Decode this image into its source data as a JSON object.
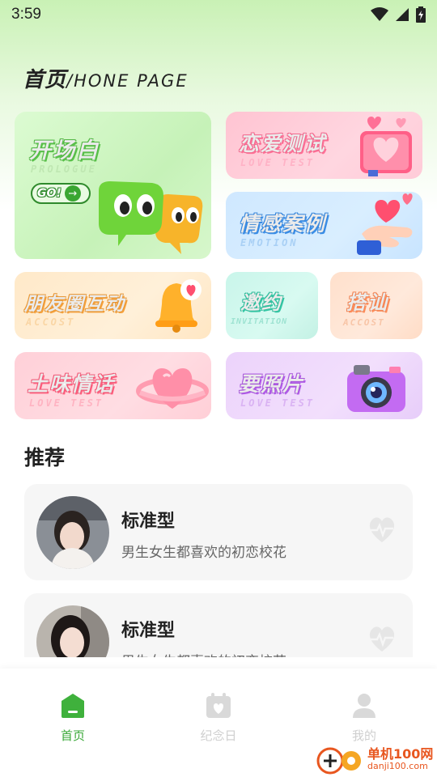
{
  "status_bar": {
    "time": "3:59"
  },
  "header": {
    "title": "首页",
    "subtitle": "/HONE PAGE"
  },
  "cards": {
    "prologue": {
      "title": "开场白",
      "subtitle": "PROLOGUE",
      "button": "GO!"
    },
    "love_test": {
      "title": "恋爱测试",
      "subtitle": "LOVE TEST"
    },
    "emotion": {
      "title": "情感案例",
      "subtitle": "EMOTION"
    },
    "moments": {
      "title": "朋友圈互动",
      "subtitle": "ACCOST"
    },
    "invitation": {
      "title": "邀约",
      "subtitle": "INVITATION"
    },
    "accost": {
      "title": "搭讪",
      "subtitle": "ACCOST"
    },
    "cheesy": {
      "title": "土味情话",
      "subtitle": "LOVE TEST"
    },
    "photo": {
      "title": "要照片",
      "subtitle": "LOVE TEST"
    }
  },
  "recommend": {
    "title": "推荐",
    "items": [
      {
        "name": "标准型",
        "desc": "男生女生都喜欢的初恋校花"
      },
      {
        "name": "标准型",
        "desc": "男生女生都喜欢的初恋校花"
      }
    ]
  },
  "tabs": [
    {
      "label": "首页",
      "active": true
    },
    {
      "label": "纪念日",
      "active": false
    },
    {
      "label": "我的",
      "active": false
    }
  ],
  "watermark": {
    "big": "单机100网",
    "small": "danji100.com"
  },
  "colors": {
    "accent": "#3aa838"
  }
}
